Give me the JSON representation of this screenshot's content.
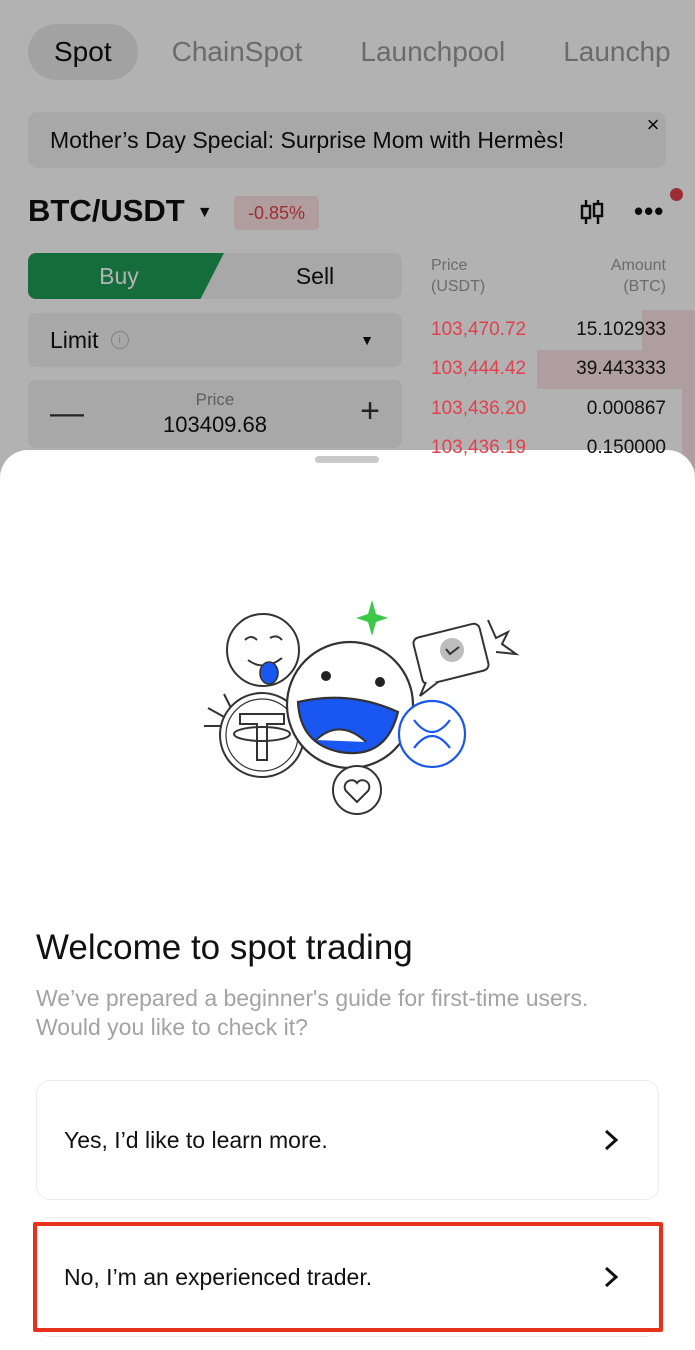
{
  "tabs": [
    "Spot",
    "ChainSpot",
    "Launchpool",
    "Launchp"
  ],
  "promo": {
    "text": "Mother’s Day Special: Surprise Mom with Hermès!",
    "close": "×"
  },
  "pair": {
    "symbol": "BTC/USDT",
    "change": "-0.85%"
  },
  "order_form": {
    "buy": "Buy",
    "sell": "Sell",
    "order_type": "Limit",
    "price_label": "Price",
    "price_value": "103409.68",
    "minus": "—",
    "plus": "+"
  },
  "order_book": {
    "price_header": [
      "Price",
      "(USDT)"
    ],
    "amount_header": [
      "Amount",
      "(BTC)"
    ],
    "rows": [
      {
        "price": "103,470.72",
        "amount": "15.102933",
        "depth": 0.2
      },
      {
        "price": "103,444.42",
        "amount": "39.443333",
        "depth": 0.6
      },
      {
        "price": "103,436.20",
        "amount": "0.000867",
        "depth": 0.05
      },
      {
        "price": "103,436.19",
        "amount": "0.150000",
        "depth": 0.05
      }
    ]
  },
  "sheet": {
    "title": "Welcome to spot trading",
    "subtitle": "We’ve prepared a beginner's guide for first-time users. Would you like to check it?",
    "options": [
      {
        "label": "Yes, I’d like to learn more."
      },
      {
        "label": "No, I’m an experienced trader."
      }
    ]
  },
  "colors": {
    "buy_green": "#1f9d55",
    "sell_red": "#e0414d",
    "illustration_blue": "#1a56f0",
    "sparkle_green": "#3ec84a",
    "highlight_red": "#e8311a"
  }
}
